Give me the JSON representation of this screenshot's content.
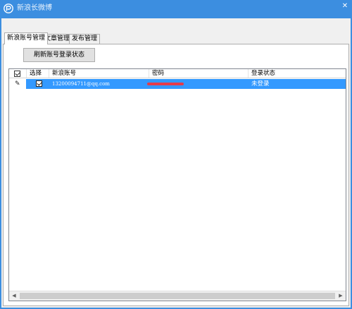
{
  "window": {
    "title": "新浪长微博",
    "icon": "app-logo-icon",
    "close_glyph": "✕"
  },
  "tabs": [
    {
      "label": "新浪账号管理",
      "active": true
    },
    {
      "label": "文章管理",
      "active": false
    },
    {
      "label": "发布管理",
      "active": false
    }
  ],
  "toolbar": {
    "refresh_label": "刷新账号登录状态"
  },
  "grid": {
    "columns": [
      "选择",
      "新浪账号",
      "密码",
      "登录状态"
    ],
    "rows": [
      {
        "selected": true,
        "account": "13200094711@qq.com",
        "password": "",
        "status": "未登录"
      }
    ],
    "row_icon": "pencil-icon"
  },
  "colors": {
    "titlebar": "#3c8ee0",
    "selection": "#3399ff",
    "redaction": "#e53b4a"
  },
  "scrollbar": {
    "left_glyph": "◀",
    "right_glyph": "▶"
  }
}
